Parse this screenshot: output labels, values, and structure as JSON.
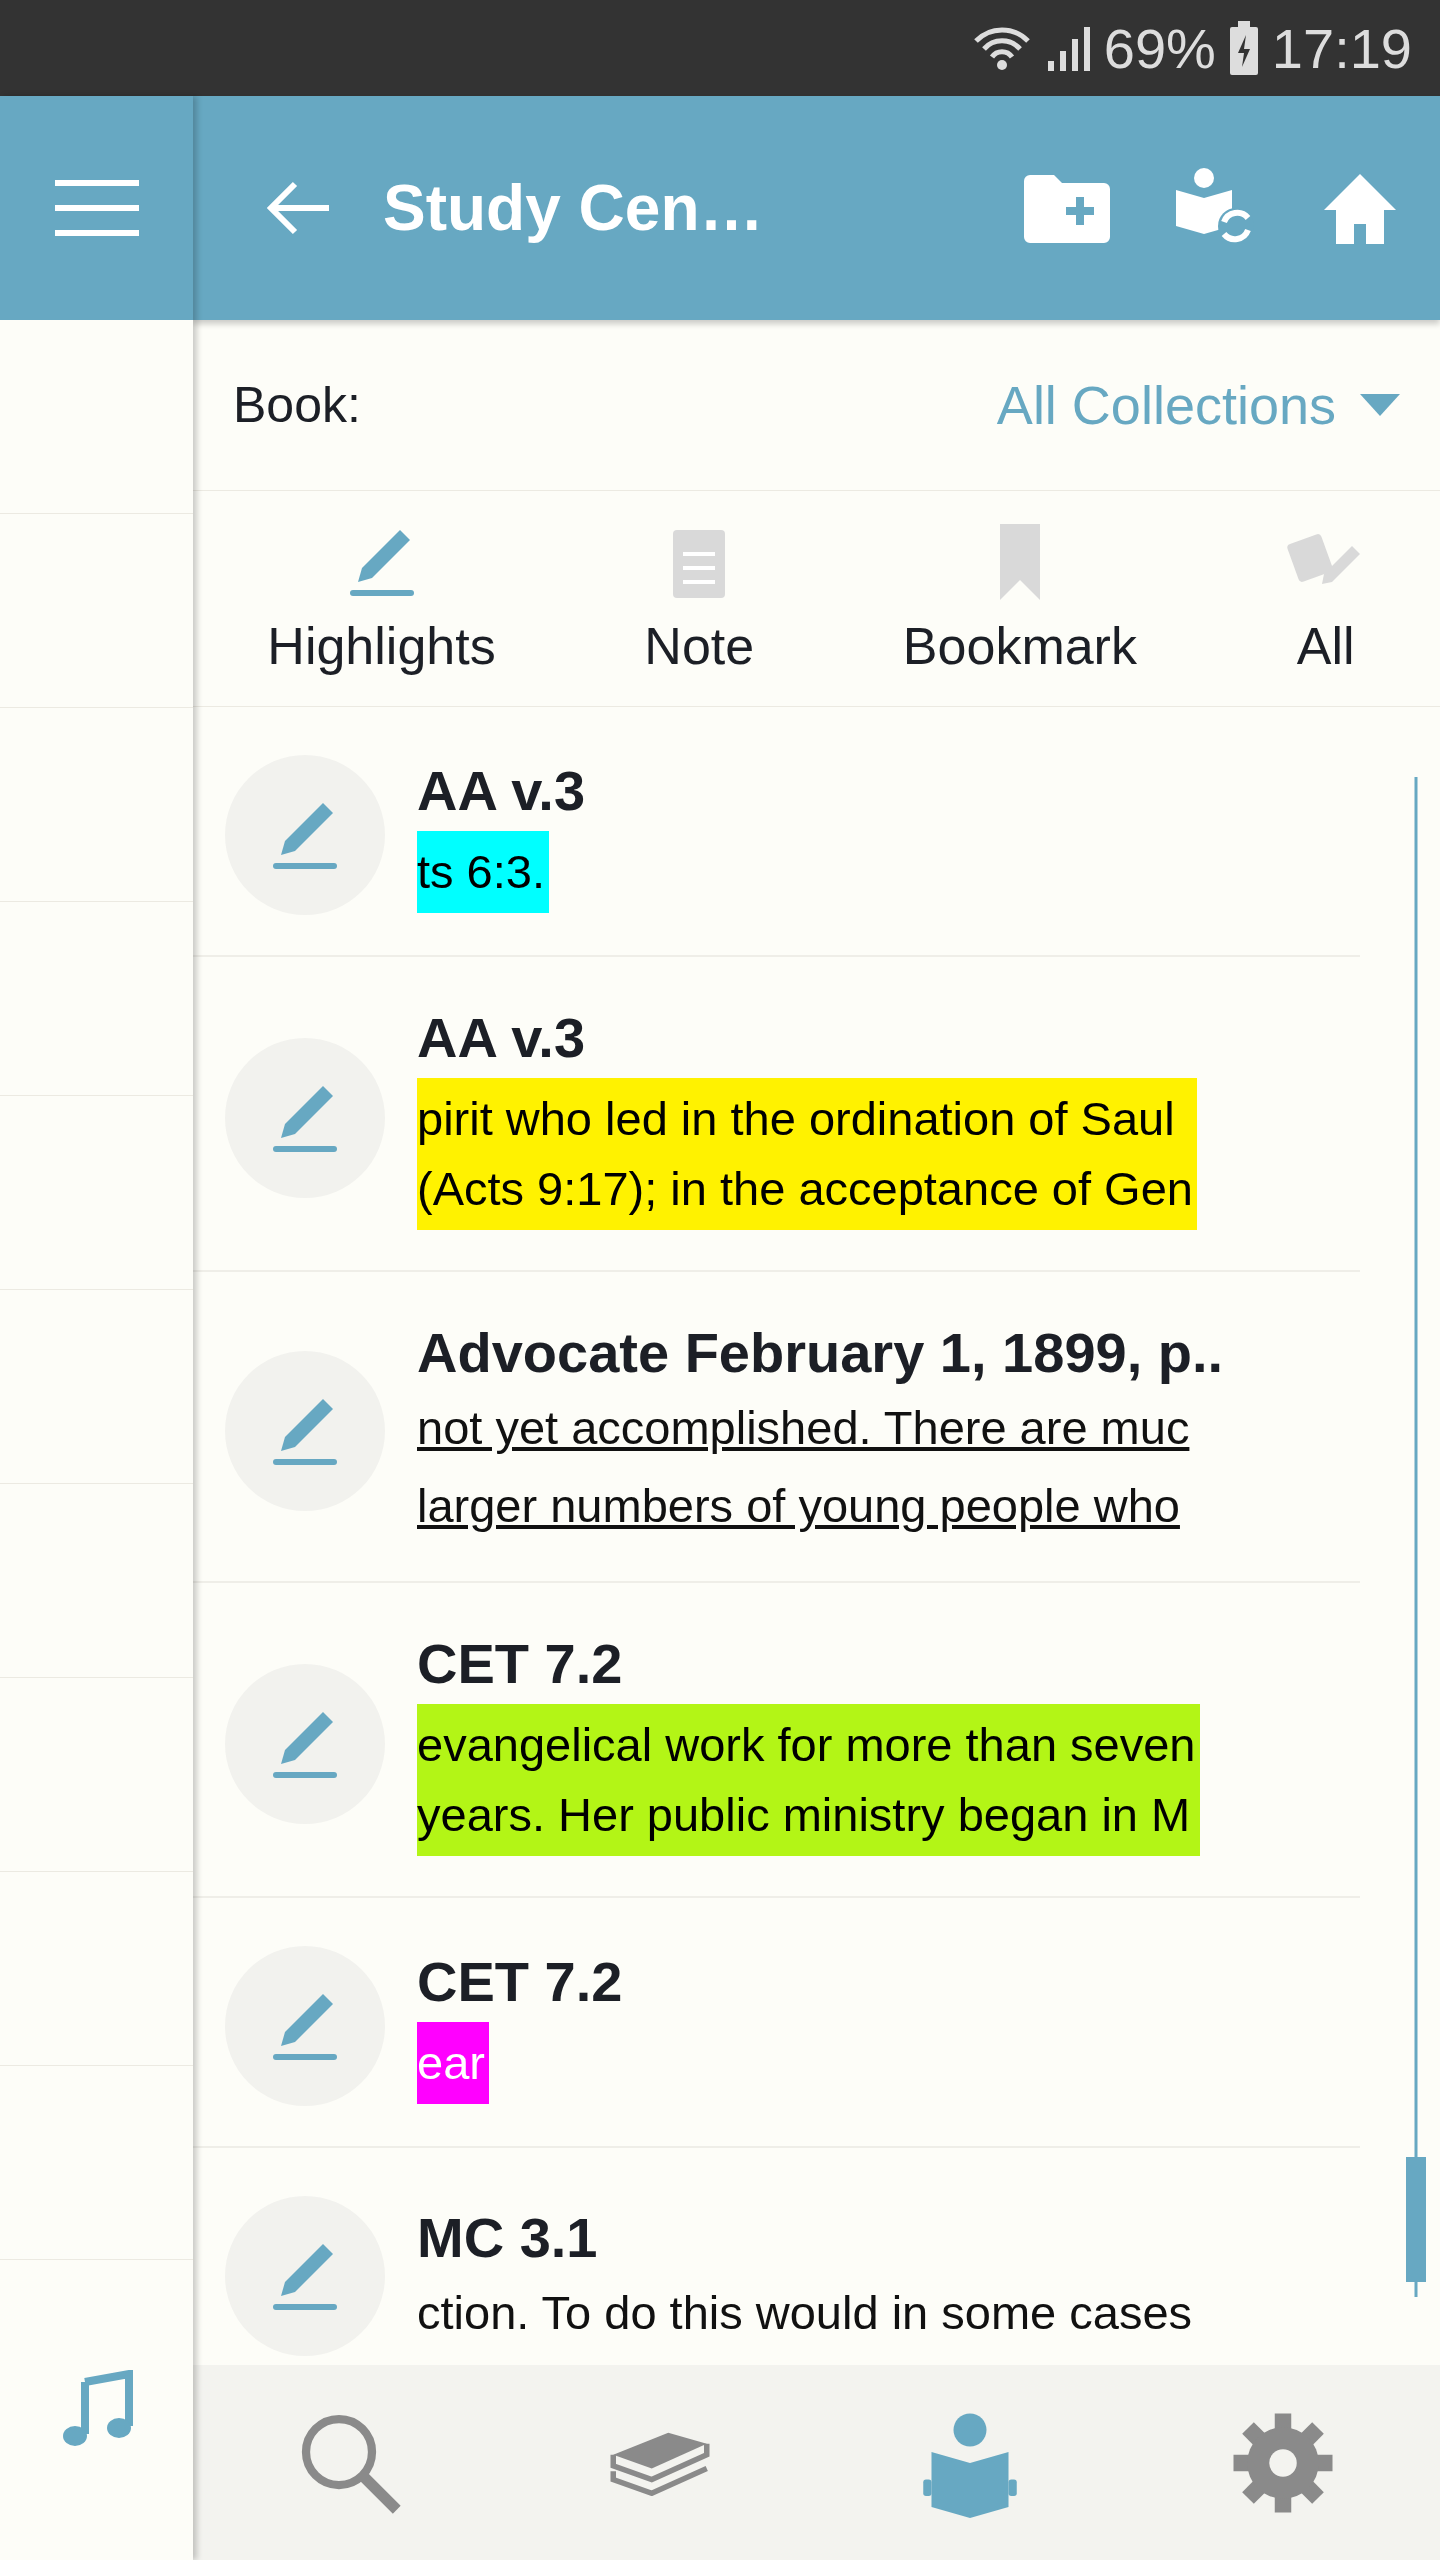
{
  "status_bar": {
    "battery": "69%",
    "time": "17:19"
  },
  "header": {
    "title": "Study Cen…"
  },
  "filter": {
    "label": "Book:",
    "value": "All Collections"
  },
  "tabs": [
    {
      "label": "Highlights",
      "kind": "highlight",
      "selected": true
    },
    {
      "label": "Note",
      "kind": "note",
      "selected": false
    },
    {
      "label": "Bookmark",
      "kind": "bookmark",
      "selected": false
    },
    {
      "label": "All",
      "kind": "all",
      "selected": false
    }
  ],
  "items": [
    {
      "title": "AA v.3",
      "kind": "highlight",
      "color": "#00ffff",
      "lines": [
        "ts 6:3."
      ]
    },
    {
      "title": "AA v.3",
      "kind": "highlight",
      "color": "#fff200",
      "lines": [
        "pirit who led in the ordination of Saul",
        "(Acts 9:17); in the acceptance of Gen"
      ]
    },
    {
      "title": "Advocate February 1,  1899, p..",
      "kind": "underline",
      "lines": [
        "not yet accomplished. There are muc",
        "larger numbers of young people who"
      ]
    },
    {
      "title": "CET 7.2",
      "kind": "highlight",
      "color": "#b3f516",
      "lines": [
        "evangelical work for more than seven",
        "years. Her public ministry began in M"
      ]
    },
    {
      "title": "CET 7.2",
      "kind": "highlight",
      "color": "#ff00ff",
      "lines": [
        "ear"
      ]
    },
    {
      "title": "MC 3.1",
      "kind": "plain",
      "lines": [
        "ction. To do this would in some cases"
      ]
    }
  ],
  "bottom_nav": [
    {
      "kind": "search",
      "selected": false
    },
    {
      "kind": "books",
      "selected": false
    },
    {
      "kind": "reader",
      "selected": true
    },
    {
      "kind": "settings",
      "selected": false
    }
  ]
}
